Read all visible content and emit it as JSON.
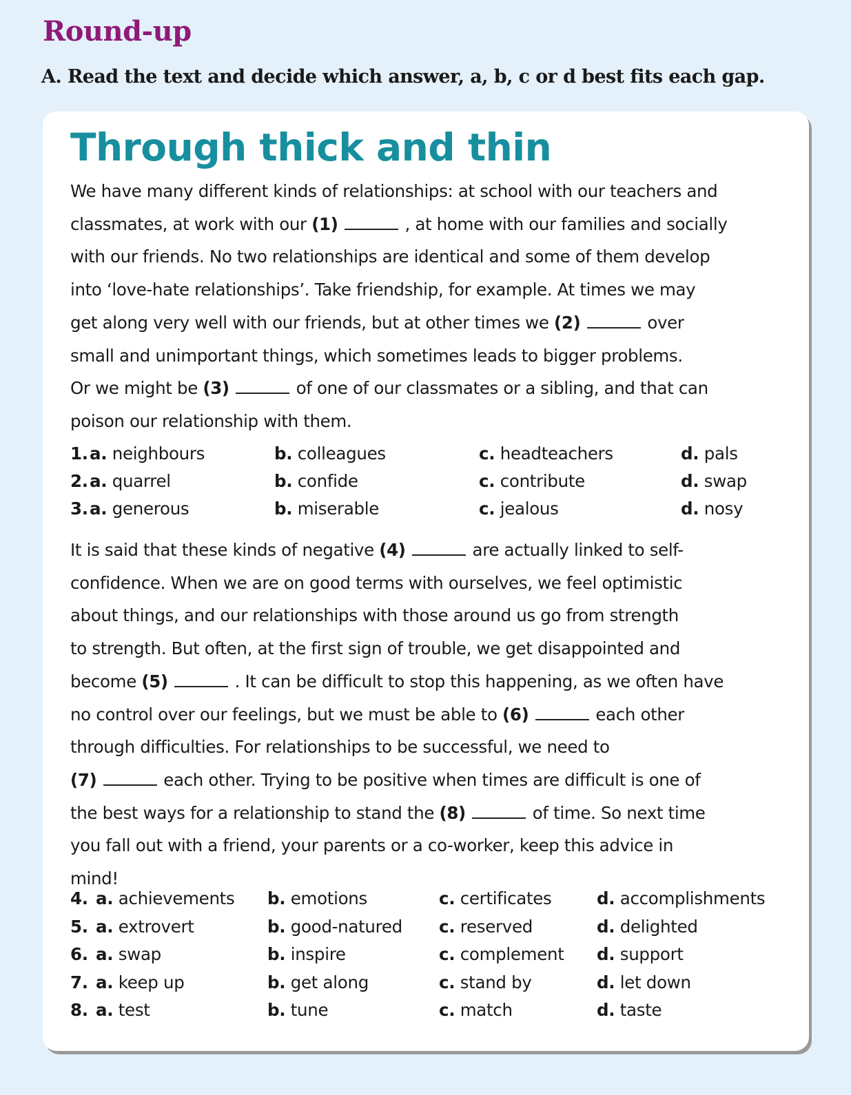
{
  "section_title": "Round-up",
  "instruction": "A.  Read the text and decide which answer, a, b, c or d best fits each gap.",
  "article_title": "Through thick and thin",
  "para1_lines": [
    [
      "We have many different kinds of relationships: at school with our teachers and"
    ],
    [
      "classmates, at work with our ",
      {
        "n": "1"
      },
      " , at home with our families and socially"
    ],
    [
      "with our friends. No two relationships are identical and some of them develop"
    ],
    [
      "into ‘love-hate relationships’. Take friendship, for example. At times we may"
    ],
    [
      "get along very well with our friends, but at other times we ",
      {
        "n": "2"
      },
      " over"
    ],
    [
      "small and unimportant things, which sometimes leads to bigger problems."
    ],
    [
      "Or we might be ",
      {
        "n": "3"
      },
      " of one of our classmates or a sibling, and that can"
    ],
    [
      "poison our relationship with them."
    ]
  ],
  "para2_lines": [
    [
      "It is said that these kinds of negative  ",
      {
        "n": "4"
      },
      " are actually linked to self-"
    ],
    [
      "confidence. When we are on good terms with ourselves, we feel optimistic"
    ],
    [
      "about things, and our relationships with those around us go from strength"
    ],
    [
      "to strength. But often, at the first sign of trouble, we get disappointed and"
    ],
    [
      "become ",
      {
        "n": "5"
      },
      " . It can be difficult to stop this happening, as we often have"
    ],
    [
      "no control over our feelings, but we must be able to ",
      {
        "n": "6"
      },
      " each other"
    ],
    [
      "through difficulties. For relationships to be successful, we need to"
    ],
    [
      {
        "n": "7"
      },
      " each other. Trying to be positive when times are difficult is one of"
    ],
    [
      "the best ways for a relationship to stand the ",
      {
        "n": "8"
      },
      " of time. So next time"
    ],
    [
      "you fall out with a friend, your parents or a co-worker, keep this advice in"
    ],
    [
      "mind!"
    ]
  ],
  "questions_1_3": [
    {
      "num": "1.",
      "a": "neighbours",
      "b": "colleagues",
      "c": "headteachers",
      "d": "pals"
    },
    {
      "num": "2.",
      "a": "quarrel",
      "b": "confide",
      "c": "contribute",
      "d": "swap"
    },
    {
      "num": "3.",
      "a": "generous",
      "b": "miserable",
      "c": "jealous",
      "d": "nosy"
    }
  ],
  "questions_4_8": [
    {
      "num": "4.",
      "a": "achievements",
      "b": "emotions",
      "c": "certificates",
      "d": "accomplishments"
    },
    {
      "num": "5.",
      "a": "extrovert",
      "b": "good-natured",
      "c": "reserved",
      "d": "delighted"
    },
    {
      "num": "6.",
      "a": "swap",
      "b": "inspire",
      "c": "complement",
      "d": "support"
    },
    {
      "num": "7.",
      "a": "keep up",
      "b": "get along",
      "c": "stand by",
      "d": "let down"
    },
    {
      "num": "8.",
      "a": "test",
      "b": "tune",
      "c": "match",
      "d": "taste"
    }
  ],
  "option_letters": {
    "a": "a.",
    "b": "b.",
    "c": "c.",
    "d": "d."
  },
  "colors": {
    "section_title": "#8e1a78",
    "article_title": "#178f9f",
    "background": "#e4f1fb"
  }
}
